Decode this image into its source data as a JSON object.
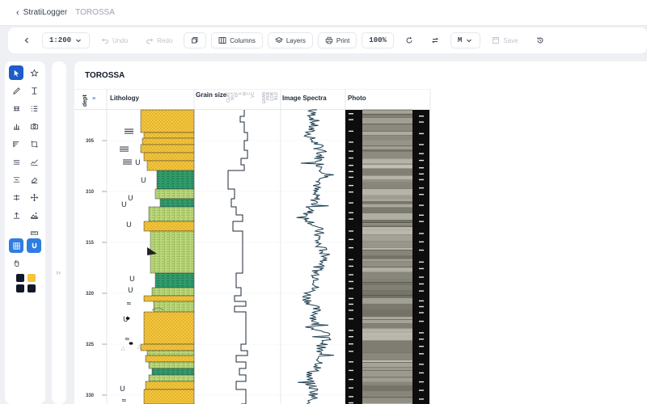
{
  "topbar": {
    "app_name": "StratiLogger",
    "breadcrumb": "TOROSSA"
  },
  "toolbar": {
    "scale": "1:200",
    "undo": "Undo",
    "redo": "Redo",
    "columns": "Columns",
    "layers": "Layers",
    "print": "Print",
    "zoom": "100%",
    "units": "M",
    "save": "Save"
  },
  "document": {
    "title": "TOROSSA"
  },
  "columns": {
    "depth": "dept",
    "lithology": "Lithology",
    "grain_size": "Grain size",
    "image_spectra": "Image Spectra",
    "photo": "Photo"
  },
  "grain_size_ticks": [
    "CLAY",
    "SILT",
    "VF",
    "F",
    "M",
    "C",
    "VC",
    "GRAN",
    "PEB",
    "COB",
    "BLD"
  ],
  "depth_labels": [
    "305",
    "310",
    "315",
    "320",
    "325",
    "330"
  ],
  "colors": {
    "accent": "#1e5cc9",
    "sandstone": "#f5c53a",
    "mudstone_green": "#2f9a6a",
    "siltstone_green": "#b9d77a",
    "spectra_line": "#1d3f52"
  }
}
